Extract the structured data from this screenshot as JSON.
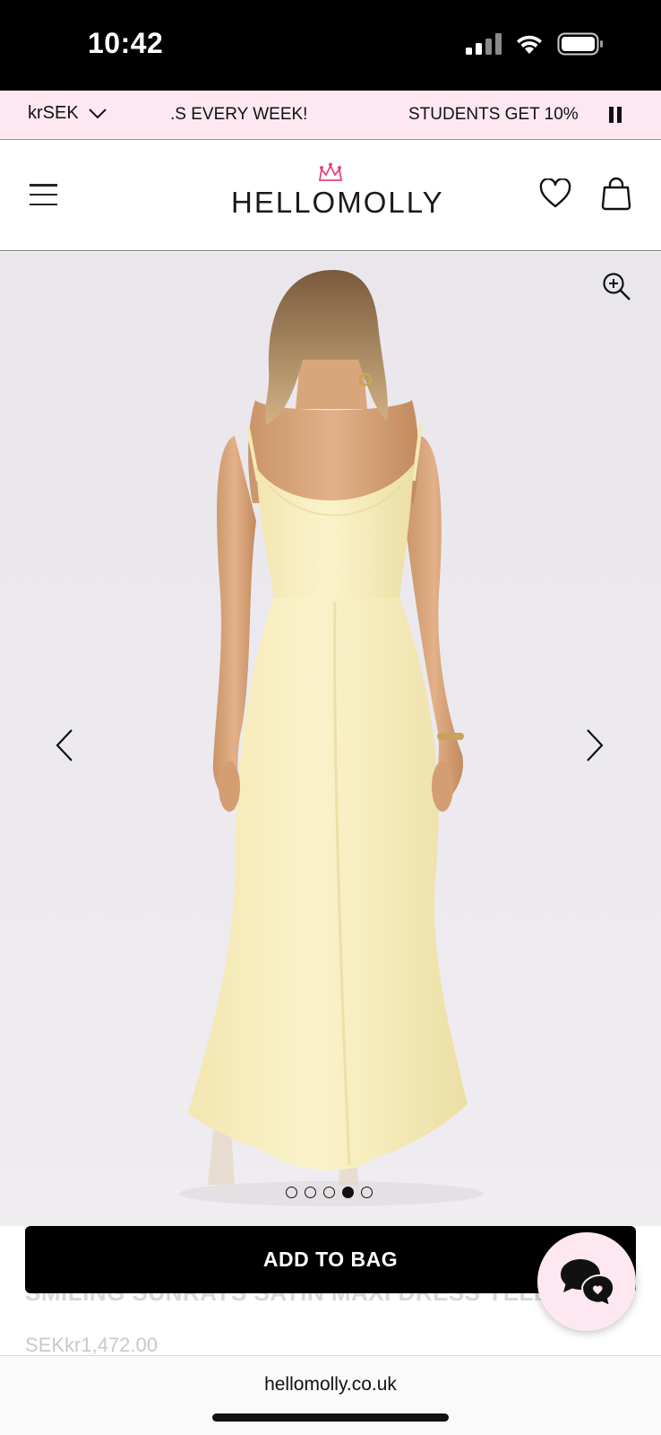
{
  "status_bar": {
    "time": "10:42"
  },
  "promo_bar": {
    "currency": "krSEK",
    "messages": [
      ".S EVERY WEEK!",
      "STUDENTS GET 10%"
    ]
  },
  "header": {
    "logo": "HELLOMOLLY"
  },
  "carousel": {
    "total_images": 5,
    "active_index": 3
  },
  "product": {
    "title": "SMILING SUNRAYS SATIN MAXI DRESS YELL",
    "price": "SEKkr1,472.00"
  },
  "cta": {
    "add_to_bag_label": "ADD TO BAG"
  },
  "browser": {
    "url": "hellomolly.co.uk"
  },
  "colors": {
    "promo_bg": "#fde8f1",
    "dress_yellow": "#f7eec0",
    "cta_bg": "#000000"
  }
}
